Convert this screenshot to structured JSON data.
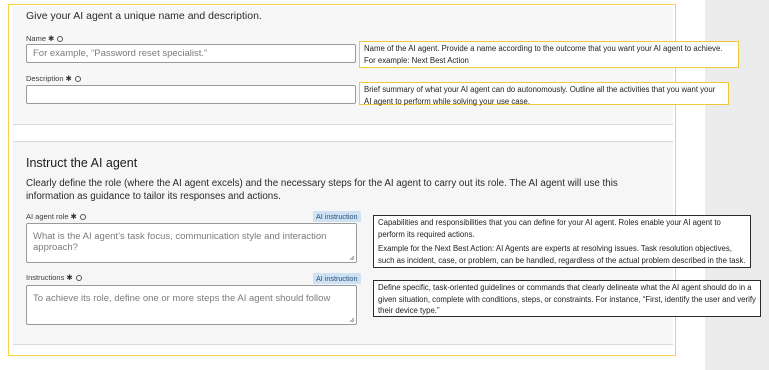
{
  "intro_text": "Give your AI agent a unique name and description.",
  "name_field": {
    "label": "Name",
    "required_mark": "✱",
    "placeholder": "For example, “Password reset specialist.”",
    "callout": "Name of the AI agent. Provide a name according to the outcome that you want your AI agent to achieve. For example: Next Best Action"
  },
  "description_field": {
    "label": "Description",
    "required_mark": "✱",
    "placeholder": "",
    "callout": "Brief summary of what your AI agent can do autonomously. Outline all the activities that you want your AI agent to perform while solving your use case."
  },
  "instruct_section": {
    "title": "Instruct the AI agent",
    "description": "Clearly define the role (where the AI agent excels) and the necessary steps for the AI agent to carry out its role. The AI agent will use this information as guidance to tailor its responses and actions."
  },
  "role_field": {
    "label": "AI agent role",
    "required_mark": "✱",
    "tag": "AI instruction",
    "placeholder": "What is the AI agent’s task focus, communication style and interaction approach?",
    "callout_p1": "Capabilities and responsibilities that you can define for your AI agent. Roles enable your AI agent to perform its required actions.",
    "callout_p2": "Example for the Next Best Action: AI Agents are experts at resolving issues. Task resolution objectives, such as incident, case, or problem, can be handled, regardless of the actual problem described in the task."
  },
  "instructions_field": {
    "label": "Instructions",
    "required_mark": "✱",
    "tag": "AI instruction",
    "placeholder": "To achieve its role, define one or more steps the AI agent should follow",
    "callout": "Define specific, task-oriented guidelines or commands that clearly delineate what the AI agent should do in a given situation, complete with conditions, steps, or constraints. For instance, “First, identify the user and verify their device type.”"
  },
  "colors": {
    "highlight_border": "#f5d24a",
    "callout_dark_border": "#2b2b2b",
    "tag_background": "#cfe2f3"
  }
}
